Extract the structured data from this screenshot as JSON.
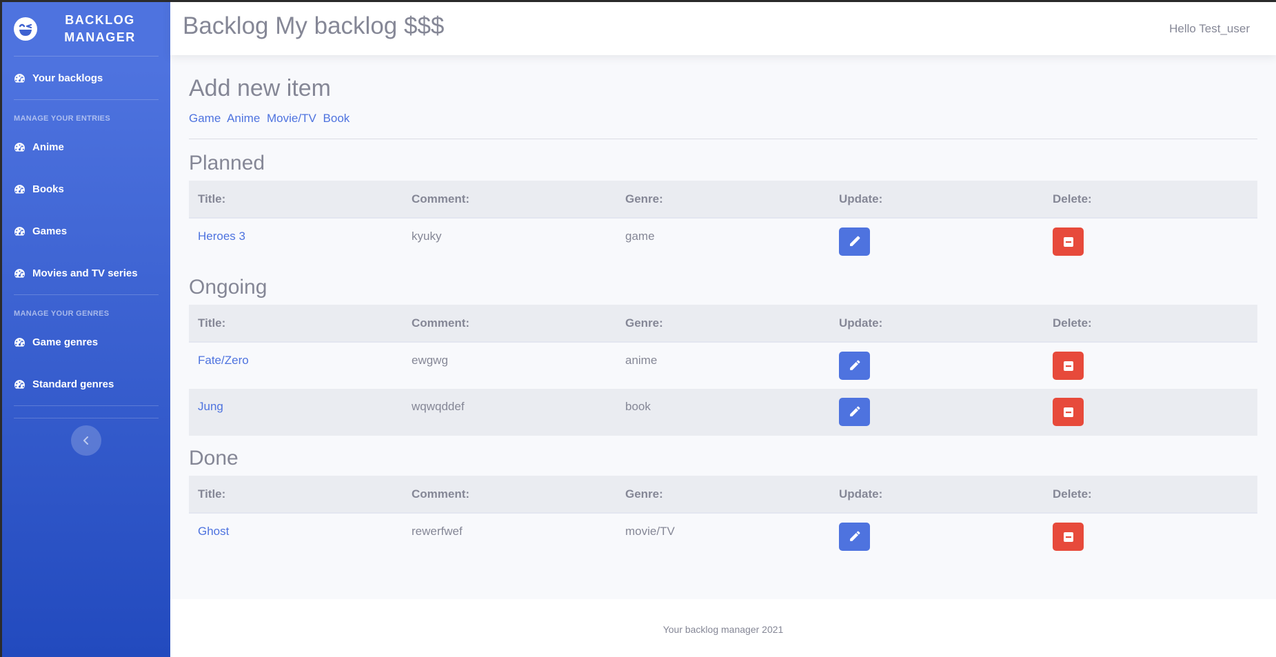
{
  "brand": {
    "line1": "BACKLOG",
    "line2": "MANAGER",
    "icon": "laugh-wink-icon"
  },
  "sidebar": {
    "your_backlogs": "Your backlogs",
    "heading_entries": "MANAGE YOUR ENTRIES",
    "entries": [
      "Anime",
      "Books",
      "Games",
      "Movies and TV series"
    ],
    "heading_genres": "MANAGE YOUR GENRES",
    "genres": [
      "Game genres",
      "Standard genres"
    ],
    "toggle_icon": "chevron-left-icon"
  },
  "topbar": {
    "title": "Backlog My backlog $$$",
    "user": "Hello Test_user"
  },
  "add": {
    "title": "Add new item",
    "links": [
      "Game",
      "Anime",
      "Movie/TV",
      "Book"
    ]
  },
  "columns": {
    "title": "Title:",
    "comment": "Comment:",
    "genre": "Genre:",
    "update": "Update:",
    "delete": "Delete:"
  },
  "sections": {
    "planned": {
      "title": "Planned",
      "rows": [
        {
          "title": "Heroes 3",
          "comment": "kyuky",
          "genre": "game"
        }
      ]
    },
    "ongoing": {
      "title": "Ongoing",
      "rows": [
        {
          "title": "Fate/Zero",
          "comment": "ewgwg",
          "genre": "anime"
        },
        {
          "title": "Jung",
          "comment": "wqwqddef",
          "genre": "book"
        }
      ]
    },
    "done": {
      "title": "Done",
      "rows": [
        {
          "title": "Ghost",
          "comment": "rewerfwef",
          "genre": "movie/TV"
        }
      ]
    }
  },
  "footer": {
    "text": "Your backlog manager 2021"
  },
  "colors": {
    "primary": "#4e73df",
    "danger": "#e74a3b",
    "text": "#858796"
  }
}
